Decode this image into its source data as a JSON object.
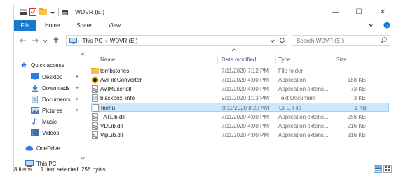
{
  "window": {
    "title": "WDVR (E:)",
    "controls": {
      "minimize": "—",
      "maximize": "☐",
      "close": "✕"
    }
  },
  "ribbon": {
    "tabs": [
      "File",
      "Home",
      "Share",
      "View"
    ],
    "expand_icon": "chevron-down-icon",
    "help_icon": "help-icon"
  },
  "address": {
    "segments": [
      "This PC",
      "WDVR (E:)"
    ],
    "search_placeholder": "Search WDVR (E:)"
  },
  "navpane": {
    "items": [
      {
        "label": "Quick access",
        "icon": "star-icon",
        "pinned": false
      },
      {
        "label": "Desktop",
        "icon": "desktop-icon",
        "pinned": true
      },
      {
        "label": "Downloads",
        "icon": "download-icon",
        "pinned": true
      },
      {
        "label": "Documents",
        "icon": "documents-icon",
        "pinned": true
      },
      {
        "label": "Pictures",
        "icon": "pictures-icon",
        "pinned": true
      },
      {
        "label": "Music",
        "icon": "music-icon",
        "pinned": false
      },
      {
        "label": "Videos",
        "icon": "videos-icon",
        "pinned": false
      },
      {
        "label": "OneDrive",
        "icon": "cloud-icon",
        "pinned": false
      },
      {
        "label": "This PC",
        "icon": "computer-icon",
        "pinned": false
      }
    ]
  },
  "list": {
    "columns": [
      "Name",
      "Date modified",
      "Type",
      "Size"
    ],
    "rows": [
      {
        "name": "tombstones",
        "date": "7/11/2020 7:12 PM",
        "type": "File folder",
        "size": "",
        "icon": "folder-icon",
        "selected": false
      },
      {
        "name": "AviFileConverter",
        "date": "7/11/2020 4:00 PM",
        "type": "Application",
        "size": "168 KB",
        "icon": "app-icon",
        "selected": false
      },
      {
        "name": "AVIMuxer.dll",
        "date": "7/11/2020 4:00 PM",
        "type": "Application extens...",
        "size": "73 KB",
        "icon": "dll-icon",
        "selected": false
      },
      {
        "name": "blackbox_info",
        "date": "9/11/2020 1:13 PM",
        "type": "Text Document",
        "size": "3 KB",
        "icon": "text-file-icon",
        "selected": false
      },
      {
        "name": "menu",
        "date": "9/11/2020 8:22 AM",
        "type": "CFG File",
        "size": "1 KB",
        "icon": "file-icon",
        "selected": true
      },
      {
        "name": "TATLib.dll",
        "date": "7/11/2020 4:00 PM",
        "type": "Application extens...",
        "size": "256 KB",
        "icon": "dll-icon",
        "selected": false
      },
      {
        "name": "VDLib.dll",
        "date": "7/11/2020 4:00 PM",
        "type": "Application extens...",
        "size": "216 KB",
        "icon": "dll-icon",
        "selected": false
      },
      {
        "name": "VipLib.dll",
        "date": "7/11/2020 4:00 PM",
        "type": "Application extens...",
        "size": "316 KB",
        "icon": "dll-icon",
        "selected": false
      }
    ]
  },
  "status": {
    "count": "8 items",
    "selection": "1 item selected  256 bytes"
  },
  "colors": {
    "accent": "#1979ca",
    "selection_bg": "#cce8ff",
    "selection_border": "#99d1ff",
    "folder": "#f3c34a"
  }
}
